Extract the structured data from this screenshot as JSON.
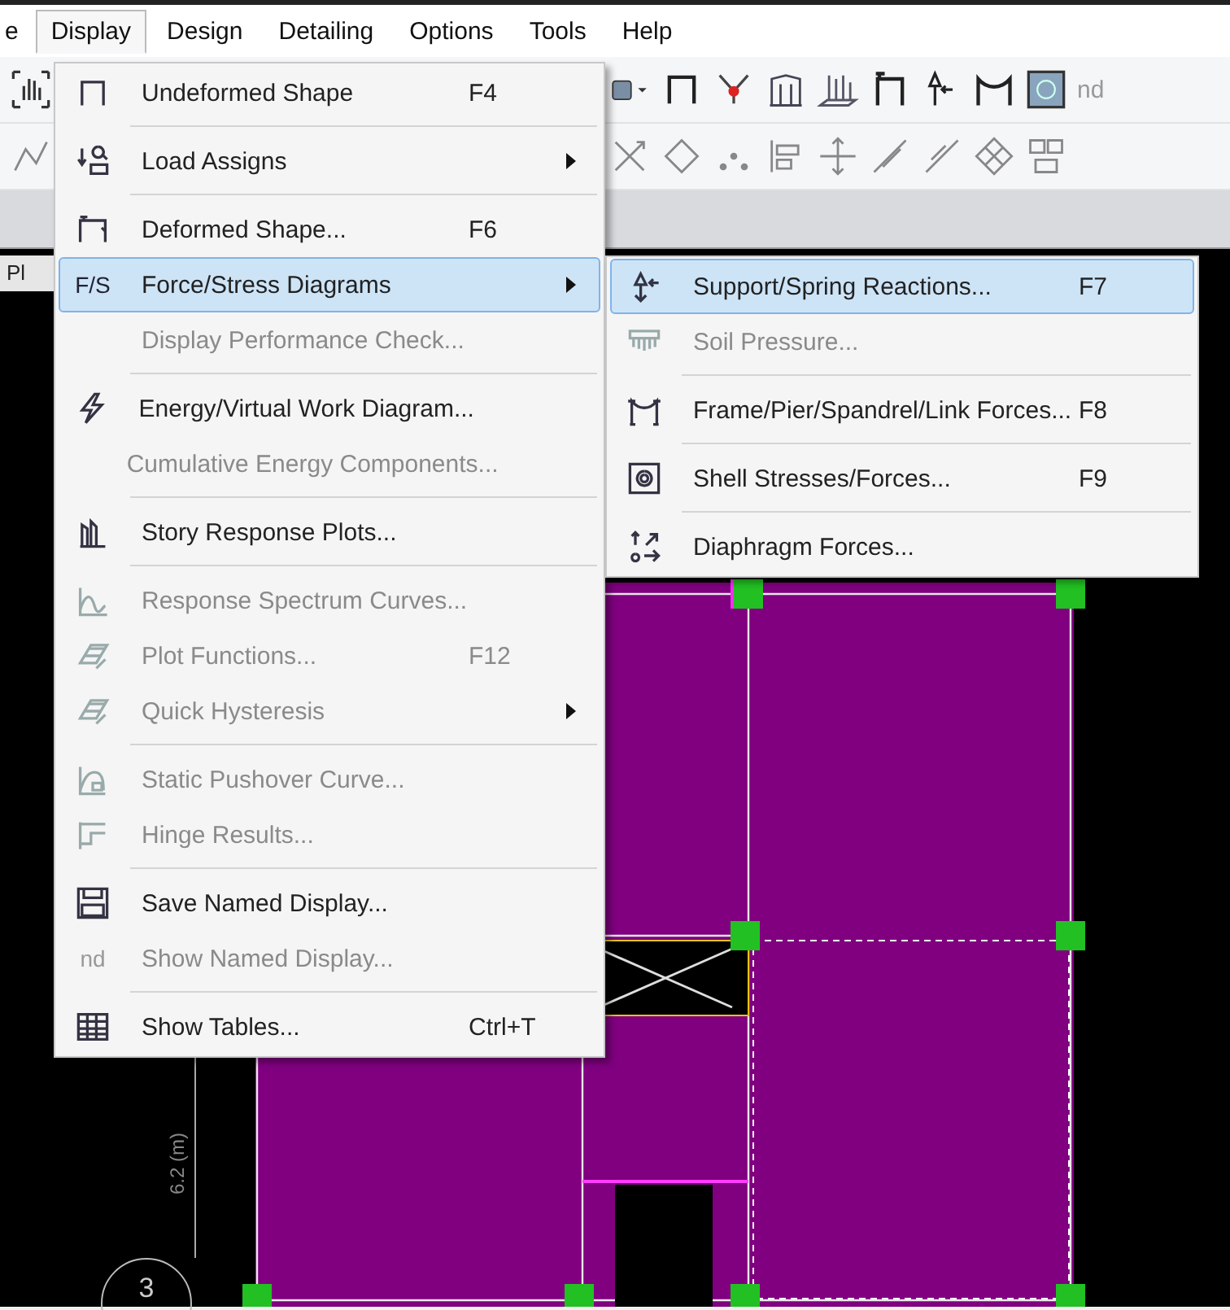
{
  "menu_bar": [
    {
      "label": "e",
      "selected": false
    },
    {
      "label": "Display",
      "selected": true
    },
    {
      "label": "Design",
      "selected": false
    },
    {
      "label": "Detailing",
      "selected": false
    },
    {
      "label": "Options",
      "selected": false
    },
    {
      "label": "Tools",
      "selected": false
    },
    {
      "label": "Help",
      "selected": false
    }
  ],
  "toolbar": {
    "text_button": "nd"
  },
  "display_menu": [
    {
      "label": "Undeformed Shape",
      "shortcut": "F4",
      "disabled": false,
      "submenu": false,
      "selected": false,
      "separator_after": true
    },
    {
      "label": "Load Assigns",
      "disabled": false,
      "submenu": true,
      "selected": false,
      "separator_after": true
    },
    {
      "label": "Deformed Shape...",
      "shortcut": "F6",
      "disabled": false,
      "submenu": false,
      "selected": false,
      "separator_after": false
    },
    {
      "label": "Force/Stress Diagrams",
      "icon_text": "F/S",
      "disabled": false,
      "submenu": true,
      "selected": true,
      "separator_after": false
    },
    {
      "label": "Display Performance Check...",
      "disabled": true,
      "submenu": false,
      "selected": false,
      "separator_after": true
    },
    {
      "label": "Energy/Virtual Work Diagram...",
      "disabled": false,
      "submenu": false,
      "selected": false,
      "separator_after": false
    },
    {
      "label": "Cumulative Energy Components...",
      "disabled": true,
      "submenu": false,
      "selected": false,
      "separator_after": true
    },
    {
      "label": "Story Response Plots...",
      "disabled": false,
      "submenu": false,
      "selected": false,
      "separator_after": true
    },
    {
      "label": "Response Spectrum Curves...",
      "disabled": true,
      "submenu": false,
      "selected": false,
      "separator_after": false
    },
    {
      "label": "Plot Functions...",
      "shortcut": "F12",
      "disabled": true,
      "submenu": false,
      "selected": false,
      "separator_after": false
    },
    {
      "label": "Quick Hysteresis",
      "disabled": true,
      "submenu": true,
      "selected": false,
      "separator_after": true
    },
    {
      "label": "Static Pushover Curve...",
      "disabled": true,
      "submenu": false,
      "selected": false,
      "separator_after": false
    },
    {
      "label": "Hinge Results...",
      "disabled": true,
      "submenu": false,
      "selected": false,
      "separator_after": true
    },
    {
      "label": "Save Named Display...",
      "disabled": false,
      "submenu": false,
      "selected": false,
      "separator_after": false
    },
    {
      "label": "Show Named Display...",
      "icon_text": "nd",
      "disabled": true,
      "submenu": false,
      "selected": false,
      "separator_after": true
    },
    {
      "label": "Show Tables...",
      "shortcut": "Ctrl+T",
      "disabled": false,
      "submenu": false,
      "selected": false,
      "separator_after": false
    }
  ],
  "force_submenu": [
    {
      "label": "Support/Spring Reactions...",
      "shortcut": "F7",
      "disabled": false,
      "selected": true,
      "separator_after": false
    },
    {
      "label": "Soil Pressure...",
      "disabled": true,
      "selected": false,
      "separator_after": true
    },
    {
      "label": "Frame/Pier/Spandrel/Link Forces...",
      "shortcut": "F8",
      "disabled": false,
      "selected": false,
      "separator_after": true
    },
    {
      "label": "Shell Stresses/Forces...",
      "shortcut": "F9",
      "disabled": false,
      "selected": false,
      "separator_after": true
    },
    {
      "label": "Diaphragm Forces...",
      "disabled": false,
      "selected": false,
      "separator_after": false
    }
  ],
  "view_tab": {
    "label": "Pl"
  },
  "canvas": {
    "dimension_label": "6.2 (m)",
    "grid_bubble": "3"
  }
}
